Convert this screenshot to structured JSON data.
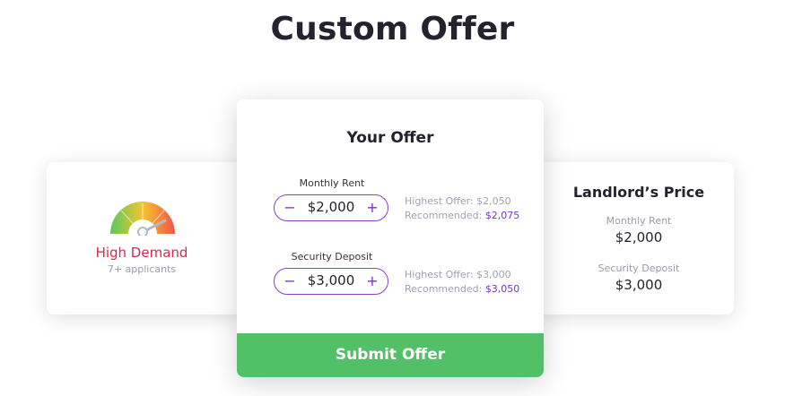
{
  "page": {
    "title": "Custom Offer"
  },
  "demand": {
    "title": "High Demand",
    "subtitle": "7+ applicants",
    "gauge_icon": "demand-gauge-icon",
    "gauge_level": 0.85,
    "colors": {
      "low": "#5ac95a",
      "mid": "#f4c430",
      "high": "#f2544a",
      "title": "#d6294f"
    }
  },
  "offer": {
    "title": "Your Offer",
    "rent": {
      "label": "Monthly Rent",
      "value": "$2,000",
      "minus": "−",
      "plus": "+",
      "highest_label": "Highest Offer:",
      "highest_value": "$2,050",
      "recommended_label": "Recommended:",
      "recommended_value": "$2,075"
    },
    "deposit": {
      "label": "Security Deposit",
      "value": "$3,000",
      "minus": "−",
      "plus": "+",
      "highest_label": "Highest Offer:",
      "highest_value": "$3,000",
      "recommended_label": "Recommended:",
      "recommended_value": "$3,050"
    },
    "submit_label": "Submit Offer",
    "colors": {
      "accent": "#7b34c6",
      "submit": "#52c067"
    }
  },
  "landlord": {
    "title": "Landlord’s Price",
    "rent_label": "Monthly Rent",
    "rent_value": "$2,000",
    "deposit_label": "Security Deposit",
    "deposit_value": "$3,000"
  }
}
